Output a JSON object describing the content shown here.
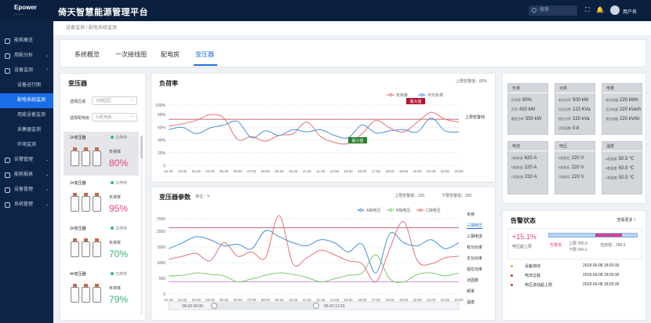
{
  "topbar": {
    "logo": "Epower",
    "logo_sub": "———",
    "title": "倚天智慧能源管理平台",
    "search_placeholder": "搜索",
    "user": "用户名"
  },
  "sidebar": {
    "items": [
      {
        "label": "能耗概览",
        "arrow": ""
      },
      {
        "label": "用能分析",
        "arrow": "⌄"
      },
      {
        "label": "设备监测",
        "arrow": "⌃"
      },
      {
        "label": "设备运行图",
        "arrow": "",
        "sub": true
      },
      {
        "label": "配电系统监测",
        "arrow": "",
        "sub": true,
        "active": true
      },
      {
        "label": "用能设备监测",
        "arrow": "",
        "sub": true
      },
      {
        "label": "采集器监测",
        "arrow": "",
        "sub": true
      },
      {
        "label": "环境监测",
        "arrow": "",
        "sub": true
      },
      {
        "label": "告警管理",
        "arrow": "⌄"
      },
      {
        "label": "能耗报表",
        "arrow": "⌄"
      },
      {
        "label": "设备管理",
        "arrow": "⌄"
      },
      {
        "label": "系统管理",
        "arrow": "⌄"
      }
    ]
  },
  "breadcrumb": "设备监测 / 配电系统监测",
  "tabs": [
    "系统概览",
    "一次接线图",
    "配电房",
    "变压器"
  ],
  "left": {
    "title": "变压器",
    "area_label": "选择区域",
    "area_value": "光明园区",
    "room_label": "选择配电房",
    "room_value": "1#配电房",
    "cards": [
      {
        "name": "1#变压器",
        "status": "工作中",
        "load_label": "负荷率",
        "value": "80%",
        "color": "#e5467a"
      },
      {
        "name": "1#变压器",
        "status": "工作中",
        "load_label": "负荷率",
        "value": "95%",
        "color": "#e5467a"
      },
      {
        "name": "3#变压器",
        "status": "工作中",
        "load_label": "负荷率",
        "value": "70%",
        "color": "#3cb371"
      },
      {
        "name": "4#变压器",
        "status": "工作中",
        "load_label": "负荷率",
        "value": "79%",
        "color": "#3cb371"
      }
    ]
  },
  "load": {
    "title": "负荷率",
    "upper_label": "上限告警值：80%",
    "upper_line_label": "上限告警线",
    "legend_a": "负荷率",
    "legend_b": "平均负荷",
    "max_label": "最大值",
    "min_label": "最小值"
  },
  "params": {
    "title": "变压器参数",
    "unit": "单位：V",
    "upper": "上限告警值：320",
    "lower": "下限告警值：320",
    "legend": [
      "A相电压",
      "B相电压",
      "C相电压"
    ],
    "right_items": [
      "负荷",
      "三相电压",
      "三相电流",
      "有功功率",
      "无功功率",
      "视在功率",
      "功因数",
      "频率",
      "温度"
    ],
    "slider_left": "06-03 06:00",
    "slider_right": "06-03 12:15"
  },
  "metrics": {
    "cards": [
      {
        "title": "负荷",
        "rows": [
          [
            "负荷率",
            "80%"
          ],
          [
            "负荷",
            "420 kW"
          ],
          [
            "额定功率",
            "550 kW"
          ]
        ]
      },
      {
        "title": "功率",
        "rows": [
          [
            "有功功率",
            "500 kW"
          ],
          [
            "无功功率",
            "123 KVa"
          ],
          [
            "视在功率",
            "220 kVa"
          ],
          [
            "功率因数",
            "0.8"
          ]
        ]
      },
      {
        "title": "电量",
        "rows": [
          [
            "有功电量",
            "220 kWh"
          ],
          [
            "无功电量",
            "220 kVarh"
          ],
          [
            "视在电量",
            "220 kVAh"
          ]
        ]
      },
      {
        "title": "电流",
        "rows": [
          [
            "A相电流",
            "620 A"
          ],
          [
            "B相电流",
            "220 A"
          ],
          [
            "C相电流",
            "220 A"
          ]
        ]
      },
      {
        "title": "电压",
        "rows": [
          [
            "A相电压",
            "220 V"
          ],
          [
            "B相电压",
            "220 V"
          ],
          [
            "C相电压",
            "220 V"
          ]
        ]
      },
      {
        "title": "温度",
        "rows": [
          [
            "A相温度",
            "50.5 ℃"
          ],
          [
            "B相温度",
            "50.5 ℃"
          ],
          [
            "C相温度",
            "50.5 ℃"
          ]
        ]
      }
    ]
  },
  "alarm": {
    "title": "告警状态",
    "more": "查看更多 〉",
    "pct": "+15.1%",
    "pct_label": "电压超上限",
    "warn": "告警值",
    "upper": "上限 395.5",
    "lower": "下限 340.1",
    "current": "当前值：395.5",
    "rows": [
      {
        "name": "设备掉线",
        "time": "2018-06-08 18:00:30",
        "color": "#f5a623"
      },
      {
        "name": "电流过载",
        "time": "2018-06-08 18:00:30",
        "color": "#c0392b"
      },
      {
        "name": "电压波动超上限",
        "time": "2018-06-08 18:00:30",
        "color": "#c0392b"
      }
    ]
  },
  "chart_data": [
    {
      "type": "line",
      "title": "负荷率",
      "x": [
        "01:30",
        "02:30",
        "03:45",
        "04:30",
        "05:45",
        "06:00",
        "07:09",
        "08:00",
        "08:30",
        "10:40",
        "11:30",
        "11:45",
        "14:08",
        "15:00",
        "16:00",
        "17:00",
        "18:00",
        "19:00",
        "20:00",
        "21:00",
        "22:00",
        "23:00"
      ],
      "yticks": [
        "100%",
        "80%",
        "60%",
        "40%",
        "20%",
        "0"
      ],
      "ylim": [
        0,
        110
      ],
      "upper": 80,
      "series": [
        {
          "name": "负荷率",
          "color": "#e57373",
          "values": [
            68,
            72,
            78,
            88,
            82,
            45,
            50,
            42,
            52,
            55,
            75,
            50,
            40,
            38,
            55,
            78,
            65,
            58,
            75,
            92,
            80,
            75
          ]
        },
        {
          "name": "平均负荷",
          "color": "#4a90d9",
          "values": [
            62,
            66,
            55,
            65,
            70,
            76,
            48,
            60,
            52,
            62,
            58,
            62,
            52,
            48,
            70,
            56,
            60,
            62,
            58,
            82,
            60,
            58
          ]
        }
      ]
    },
    {
      "type": "line",
      "title": "变压器参数",
      "x": [
        "01:30",
        "02:30",
        "03:45",
        "04:30",
        "05:45",
        "06:00",
        "07:09",
        "08:00",
        "08:30",
        "10:40",
        "11:30",
        "11:45",
        "14:08",
        "15:00",
        "16:00",
        "17:00",
        "18:00",
        "19:00",
        "20:00",
        "21:00",
        "22:00",
        "23:00"
      ],
      "yticks": [
        "2500",
        "2000",
        "1500",
        "1000",
        "500",
        "0"
      ],
      "ylim": [
        0,
        2600
      ],
      "upper": 2200,
      "lower": 400,
      "series": [
        {
          "name": "A相电压",
          "color": "#4a90d9",
          "values": [
            1500,
            1700,
            1900,
            1800,
            1600,
            1650,
            1500,
            2100,
            1900,
            1700,
            1600,
            1800,
            1700,
            1400,
            1650,
            700,
            2000,
            1700,
            1600,
            1800,
            1500,
            1700
          ]
        },
        {
          "name": "B相电压",
          "color": "#7bc96f",
          "values": [
            600,
            620,
            700,
            650,
            600,
            400,
            500,
            620,
            700,
            650,
            550,
            400,
            500,
            620,
            700,
            1300,
            500,
            400,
            650,
            700,
            600,
            700
          ]
        },
        {
          "name": "C相电压",
          "color": "#e57373",
          "values": [
            1150,
            1250,
            1350,
            1100,
            1700,
            1250,
            1400,
            1200,
            2600,
            1000,
            1200,
            1450,
            1300,
            1100,
            1000,
            400,
            1500,
            2400,
            1100,
            1000,
            1200,
            1250
          ]
        }
      ]
    }
  ]
}
